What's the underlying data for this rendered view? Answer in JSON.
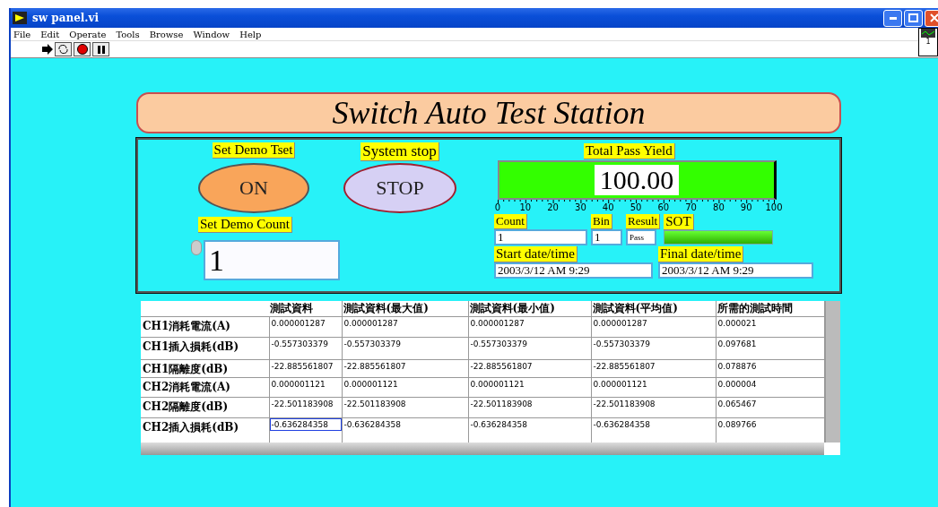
{
  "window": {
    "title": "sw panel.vi"
  },
  "menu": [
    "File",
    "Edit",
    "Operate",
    "Tools",
    "Browse",
    "Window",
    "Help"
  ],
  "connector_icon": {
    "label": "1"
  },
  "banner": {
    "title": "Switch Auto Test Station"
  },
  "demo_test": {
    "label": "Set Demo Tset",
    "button": "ON",
    "on": true
  },
  "system_stop": {
    "label": "System stop",
    "button": "STOP",
    "pressed": false
  },
  "demo_count": {
    "label": "Set Demo Count",
    "value": "1"
  },
  "pass_yield": {
    "label": "Total Pass Yield",
    "value": "100.00",
    "level": 1,
    "scale": [
      "0",
      "10",
      "20",
      "30",
      "40",
      "50",
      "60",
      "70",
      "80",
      "90",
      "100"
    ]
  },
  "count": {
    "label": "Count",
    "value": "1"
  },
  "bin": {
    "label": "Bin",
    "value": "1"
  },
  "result": {
    "label": "Result",
    "value": "Pass"
  },
  "sot": {
    "label": "SOT",
    "on": true
  },
  "start_time": {
    "label": "Start date/time",
    "value": "2003/3/12 AM 9:29"
  },
  "final_time": {
    "label": "Final date/time",
    "value": "2003/3/12 AM 9:29"
  },
  "table": {
    "columns": [
      "測試資料",
      "測試資料(最大值)",
      "測試資料(最小值)",
      "測試資料(平均值)",
      "所需的測試時間"
    ],
    "rows": [
      {
        "label": "CH1消耗電流(A)",
        "cells": [
          {
            "text": "0.000001287",
            "selected": false
          },
          {
            "text": "0.000001287",
            "selected": false
          },
          {
            "text": "0.000001287",
            "selected": false
          },
          {
            "text": "0.000001287",
            "selected": false
          },
          {
            "text": "0.000021",
            "selected": false
          }
        ]
      },
      {
        "label": "CH1插入損耗(dB)",
        "cells": [
          {
            "text": "-0.557303379",
            "selected": false
          },
          {
            "text": "-0.557303379",
            "selected": false
          },
          {
            "text": "-0.557303379",
            "selected": false
          },
          {
            "text": "-0.557303379",
            "selected": false
          },
          {
            "text": "0.097681",
            "selected": false
          }
        ]
      },
      {
        "label": "CH1隔離度(dB)",
        "cells": [
          {
            "text": "-22.885561807",
            "selected": false
          },
          {
            "text": "-22.885561807",
            "selected": false
          },
          {
            "text": "-22.885561807",
            "selected": false
          },
          {
            "text": "-22.885561807",
            "selected": false
          },
          {
            "text": "0.078876",
            "selected": false
          }
        ]
      },
      {
        "label": "CH2消耗電流(A)",
        "cells": [
          {
            "text": "0.000001121",
            "selected": false
          },
          {
            "text": "0.000001121",
            "selected": false
          },
          {
            "text": "0.000001121",
            "selected": false
          },
          {
            "text": "0.000001121",
            "selected": false
          },
          {
            "text": "0.000004",
            "selected": false
          }
        ]
      },
      {
        "label": "CH2隔離度(dB)",
        "cells": [
          {
            "text": "-22.501183908",
            "selected": false
          },
          {
            "text": "-22.501183908",
            "selected": false
          },
          {
            "text": "-22.501183908",
            "selected": false
          },
          {
            "text": "-22.501183908",
            "selected": false
          },
          {
            "text": "0.065467",
            "selected": false
          }
        ]
      },
      {
        "label": "CH2插入損耗(dB)",
        "cells": [
          {
            "text": "-0.636284358",
            "selected": true
          },
          {
            "text": "-0.636284358",
            "selected": false
          },
          {
            "text": "-0.636284358",
            "selected": false
          },
          {
            "text": "-0.636284358",
            "selected": false
          },
          {
            "text": "0.089766",
            "selected": false
          }
        ]
      }
    ]
  }
}
